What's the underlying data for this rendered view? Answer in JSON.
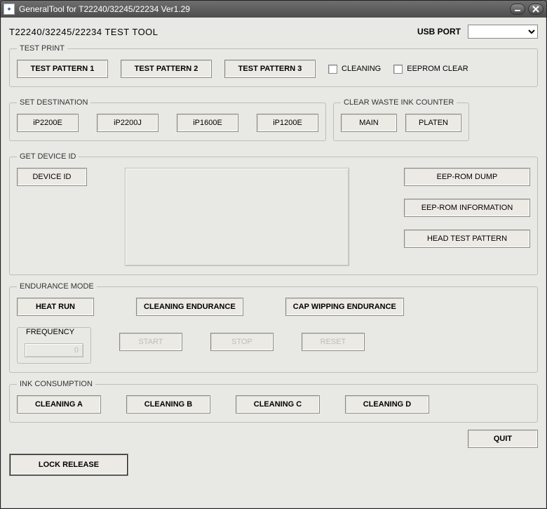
{
  "window": {
    "title": "GeneralTool for T22240/32245/22234 Ver1.29"
  },
  "header": {
    "tool_title": "T22240/32245/22234 TEST TOOL",
    "usb_port_label": "USB PORT",
    "usb_port_value": ""
  },
  "test_print": {
    "legend": "TEST PRINT",
    "pattern1": "TEST PATTERN 1",
    "pattern2": "TEST PATTERN 2",
    "pattern3": "TEST PATTERN 3",
    "cleaning_label": "CLEANING",
    "eeprom_clear_label": "EEPROM CLEAR"
  },
  "set_destination": {
    "legend": "SET DESTINATION",
    "buttons": [
      "iP2200E",
      "iP2200J",
      "iP1600E",
      "iP1200E"
    ]
  },
  "clear_waste": {
    "legend": "CLEAR WASTE INK COUNTER",
    "main": "MAIN",
    "platen": "PLATEN"
  },
  "get_device": {
    "legend": "GET DEVICE ID",
    "device_id": "DEVICE ID",
    "output": "",
    "eep_rom_dump": "EEP-ROM DUMP",
    "eep_rom_info": "EEP-ROM INFORMATION",
    "head_test": "HEAD TEST PATTERN"
  },
  "endurance": {
    "legend": "ENDURANCE MODE",
    "heat_run": "HEAT RUN",
    "cleaning_endurance": "CLEANING ENDURANCE",
    "cap_wipping": "CAP WIPPING ENDURANCE",
    "frequency_label": "FREQUENCY",
    "frequency_value": "0",
    "start": "START",
    "stop": "STOP",
    "reset": "RESET"
  },
  "ink": {
    "legend": "INK CONSUMPTION",
    "cleaning_a": "CLEANING A",
    "cleaning_b": "CLEANING B",
    "cleaning_c": "CLEANING C",
    "cleaning_d": "CLEANING D"
  },
  "bottom": {
    "quit": "QUIT",
    "lock_release": "LOCK RELEASE"
  }
}
